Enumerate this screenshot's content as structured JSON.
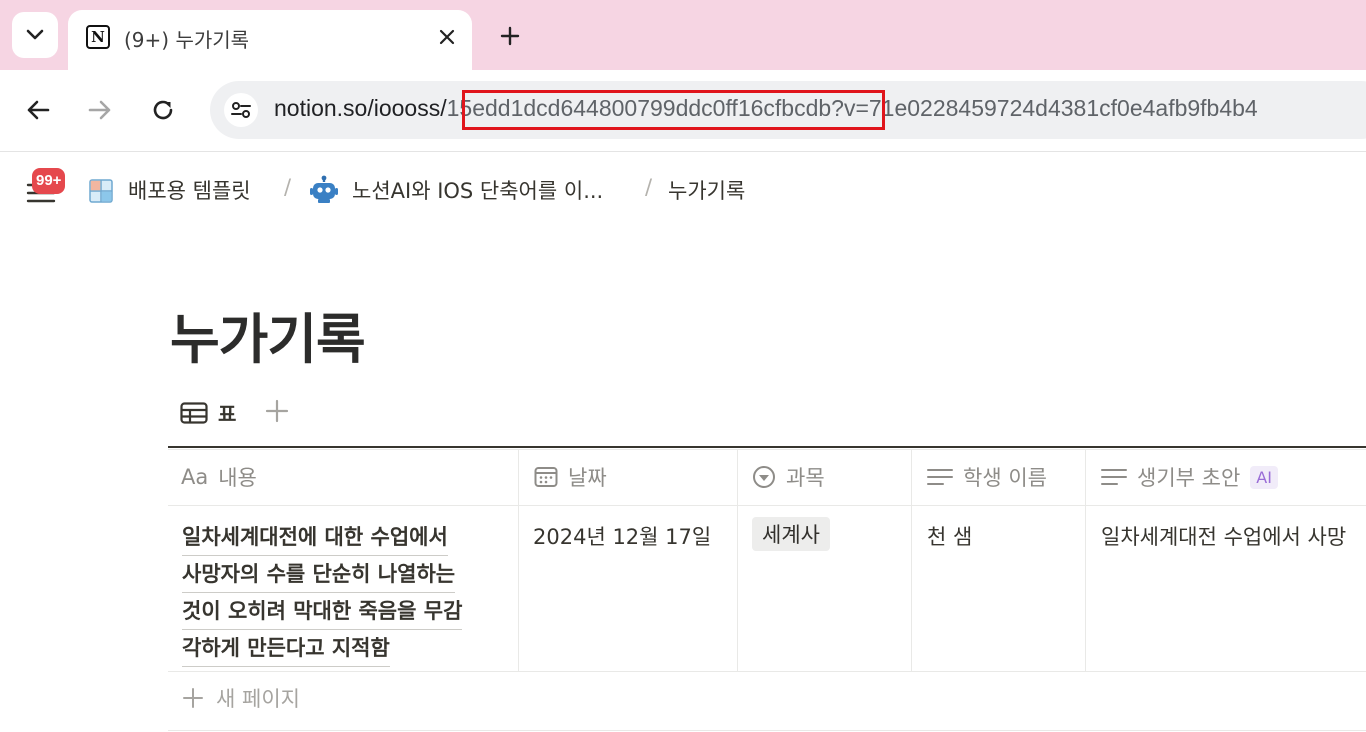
{
  "browser": {
    "tab_title": "(9+) 누가기록",
    "favicon_letter": "N",
    "url_domain": "notion.so/ioooss/",
    "url_id": "15edd1dcd644800799ddc0ff16cfbcdb",
    "url_query": "?v=71e0228459724d4381cf0e4afb9fb4b4"
  },
  "notion": {
    "badge": "99+",
    "breadcrumbs": [
      {
        "label": "배포용 템플릿",
        "icon": "grid-icon"
      },
      {
        "label": "노션AI와 IOS 단축어를 이...",
        "icon": "robot-icon"
      },
      {
        "label": "누가기록"
      }
    ],
    "separator": "/",
    "page_title": "누가기록",
    "view_tab": "표",
    "columns": [
      {
        "label": "내용",
        "prefix": "Aa"
      },
      {
        "label": "날짜"
      },
      {
        "label": "과목"
      },
      {
        "label": "학생 이름"
      },
      {
        "label": "생기부 초안",
        "chip": "AI"
      }
    ],
    "row": {
      "title_lines": [
        "일차세계대전에 대한 수업에서",
        "사망자의 수를 단순히 나열하는",
        "것이 오히려 막대한 죽음을 무감",
        "각하게 만든다고 지적함"
      ],
      "date": "2024년 12월 17일",
      "subject": "세계사",
      "student": "천 샘",
      "draft": "일차세계대전 수업에서 사망"
    },
    "new_page": "새 페이지"
  },
  "colors": {
    "tabstrip": "#f6d5e3",
    "highlight": "#e0151c",
    "badge": "#e5484d"
  }
}
